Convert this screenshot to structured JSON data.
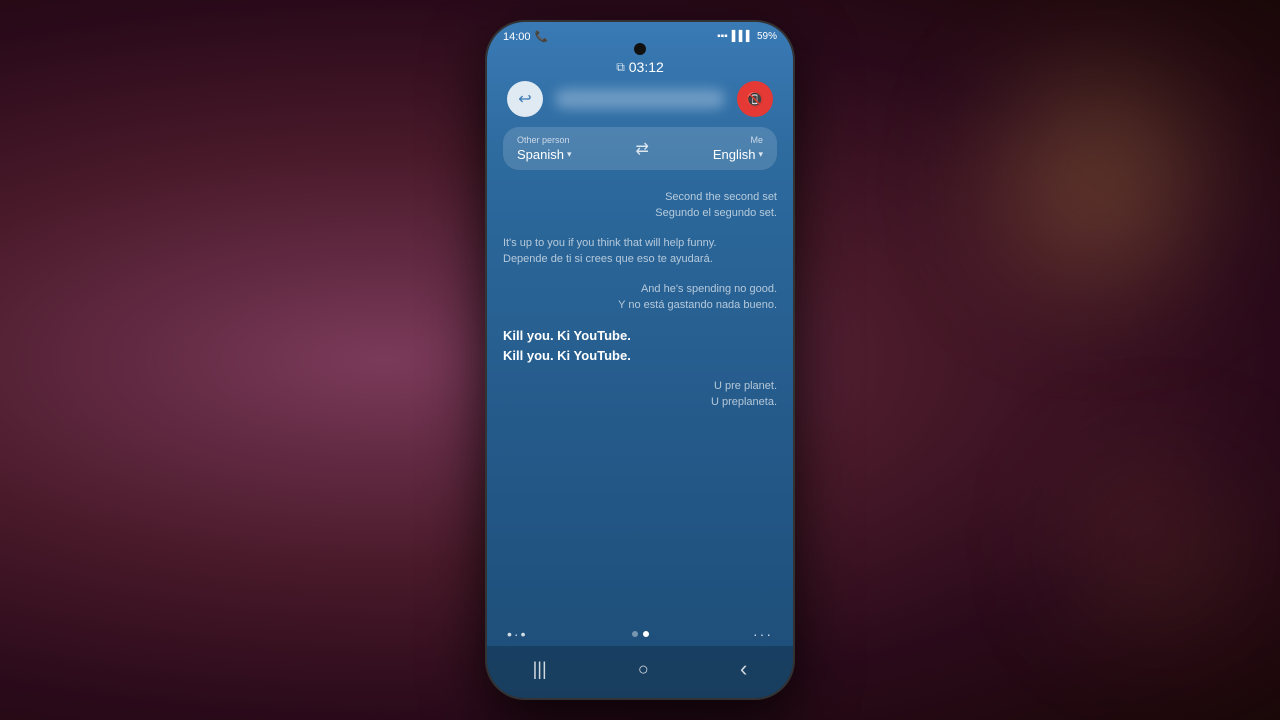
{
  "background": {
    "description": "Dark purple-brown bokeh background with hand holding phone"
  },
  "status_bar": {
    "time": "14:00",
    "signal_bars": "▌▌▌",
    "network": "LTE",
    "battery": "59%"
  },
  "call": {
    "timer_label": "03:12",
    "caller_name_blurred": true
  },
  "controls": {
    "back_button": "↩",
    "end_call_button": "📞"
  },
  "language_panel": {
    "other_person_label": "Other person",
    "other_person_lang": "Spanish",
    "me_label": "Me",
    "me_lang": "English",
    "chevron": "▾",
    "swap_icon": "⇄"
  },
  "transcript": [
    {
      "side": "right",
      "bold": false,
      "original": "Second the second set",
      "translation": "Segundo el segundo set."
    },
    {
      "side": "left",
      "bold": false,
      "original": "It's up to you if you think that will help funny.",
      "translation": "Depende de ti si crees que eso te ayudará."
    },
    {
      "side": "right",
      "bold": false,
      "original": "And he's spending no good.",
      "translation": "Y no está gastando nada bueno."
    },
    {
      "side": "left",
      "bold": true,
      "original": "Kill you. Ki YouTube.",
      "translation": "Kill you. Ki YouTube."
    },
    {
      "side": "right",
      "bold": false,
      "original": "U pre planet.",
      "translation": "U preplaneta."
    }
  ],
  "bottom_controls": {
    "left_dots": "•·•",
    "right_dots": "···",
    "page_dots": [
      "inactive",
      "active"
    ]
  },
  "nav_bar": {
    "recent_apps": "|||",
    "home": "○",
    "back": "‹"
  }
}
